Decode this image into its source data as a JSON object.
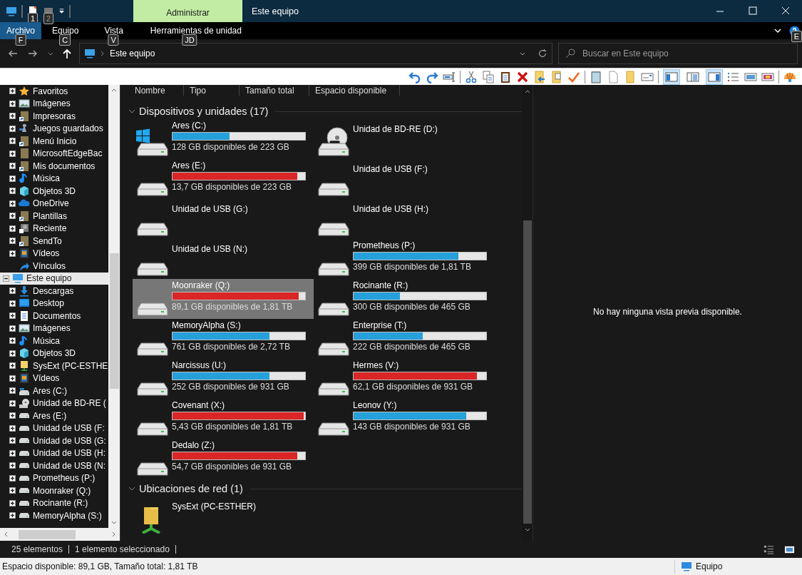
{
  "window": {
    "title": "Este equipo",
    "context_tab": "Administrar"
  },
  "quick_access_keytips": [
    "1",
    "2"
  ],
  "ribbon_tabs": [
    {
      "label": "Archivo",
      "selected": true,
      "keytip": "F"
    },
    {
      "label": "Equipo",
      "selected": false,
      "keytip": "C"
    },
    {
      "label": "Vista",
      "selected": false,
      "keytip": "V"
    },
    {
      "label": "Herramientas de unidad",
      "selected": false,
      "keytip": "JD"
    }
  ],
  "help_keytip": "E",
  "address": {
    "location": "Este equipo"
  },
  "search": {
    "placeholder": "Buscar en Este equipo"
  },
  "view_buttons": [
    {
      "selected": true
    },
    {
      "selected": false
    },
    {
      "selected": true
    }
  ],
  "sidebar": {
    "items": [
      {
        "label": "Favoritos",
        "kind": "star",
        "expandable": true,
        "expanded": false,
        "selected": false
      },
      {
        "label": "Imágenes",
        "kind": "pictures",
        "expandable": true,
        "expanded": false,
        "selected": false
      },
      {
        "label": "Impresoras",
        "kind": "shortcut-folder",
        "expandable": true,
        "expanded": false,
        "selected": false
      },
      {
        "label": "Juegos guardados",
        "kind": "games",
        "expandable": true,
        "expanded": false,
        "selected": false
      },
      {
        "label": "Menú Inicio",
        "kind": "shortcut-folder",
        "expandable": true,
        "expanded": false,
        "selected": false
      },
      {
        "label": "MicrosoftEdgeBac",
        "kind": "folder",
        "expandable": true,
        "expanded": false,
        "selected": false
      },
      {
        "label": "Mis documentos",
        "kind": "shortcut-folder",
        "expandable": true,
        "expanded": false,
        "selected": false
      },
      {
        "label": "Música",
        "kind": "music",
        "expandable": true,
        "expanded": false,
        "selected": false
      },
      {
        "label": "Objetos 3D",
        "kind": "cube",
        "expandable": true,
        "expanded": false,
        "selected": false
      },
      {
        "label": "OneDrive",
        "kind": "cloud",
        "expandable": true,
        "expanded": false,
        "selected": false
      },
      {
        "label": "Plantillas",
        "kind": "shortcut-folder",
        "expandable": true,
        "expanded": false,
        "selected": false
      },
      {
        "label": "Reciente",
        "kind": "recent",
        "expandable": true,
        "expanded": false,
        "selected": false
      },
      {
        "label": "SendTo",
        "kind": "shortcut-folder",
        "expandable": true,
        "expanded": false,
        "selected": false
      },
      {
        "label": "Vídeos",
        "kind": "videos",
        "expandable": true,
        "expanded": false,
        "selected": false
      },
      {
        "label": "Vínculos",
        "kind": "link",
        "expandable": false,
        "selected": false
      },
      {
        "label": "Este equipo",
        "kind": "computer",
        "expandable": true,
        "expanded": true,
        "selected": true,
        "children": [
          {
            "label": "Descargas",
            "kind": "download",
            "expandable": true,
            "expanded": false,
            "selected": false
          },
          {
            "label": "Desktop",
            "kind": "desktop",
            "expandable": true,
            "expanded": false,
            "selected": false
          },
          {
            "label": "Documentos",
            "kind": "documents",
            "expandable": true,
            "expanded": false,
            "selected": false
          },
          {
            "label": "Imágenes",
            "kind": "pictures",
            "expandable": true,
            "expanded": false,
            "selected": false
          },
          {
            "label": "Música",
            "kind": "music",
            "expandable": true,
            "expanded": false,
            "selected": false
          },
          {
            "label": "Objetos 3D",
            "kind": "cube",
            "expandable": true,
            "expanded": false,
            "selected": false
          },
          {
            "label": "SysExt (PC-ESTHE",
            "kind": "network-folder",
            "expandable": true,
            "expanded": false,
            "selected": false
          },
          {
            "label": "Vídeos",
            "kind": "videos",
            "expandable": true,
            "expanded": false,
            "selected": false
          },
          {
            "label": "Ares (C:)",
            "kind": "windows-drive",
            "expandable": true,
            "expanded": false,
            "selected": false
          },
          {
            "label": "Unidad de BD-RE (",
            "kind": "disc-drive",
            "expandable": true,
            "expanded": false,
            "selected": false
          },
          {
            "label": "Ares (E:)",
            "kind": "drive",
            "expandable": true,
            "expanded": false,
            "selected": false
          },
          {
            "label": "Unidad de USB (F:",
            "kind": "drive",
            "expandable": true,
            "expanded": false,
            "selected": false
          },
          {
            "label": "Unidad de USB (G:",
            "kind": "drive",
            "expandable": true,
            "expanded": false,
            "selected": false
          },
          {
            "label": "Unidad de USB (H:",
            "kind": "drive",
            "expandable": true,
            "expanded": false,
            "selected": false
          },
          {
            "label": "Unidad de USB (N:",
            "kind": "drive",
            "expandable": true,
            "expanded": false,
            "selected": false
          },
          {
            "label": "Prometheus (P:)",
            "kind": "drive",
            "expandable": true,
            "expanded": false,
            "selected": false
          },
          {
            "label": "Moonraker (Q:)",
            "kind": "drive",
            "expandable": true,
            "expanded": false,
            "selected": false
          },
          {
            "label": "Rocinante (R:)",
            "kind": "drive",
            "expandable": true,
            "expanded": false,
            "selected": false
          },
          {
            "label": "MemoryAlpha (S:)",
            "kind": "drive",
            "expandable": true,
            "expanded": false,
            "selected": false
          }
        ]
      }
    ]
  },
  "columns": [
    "Nombre",
    "Tipo",
    "Tamaño total",
    "Espacio disponible"
  ],
  "groups": [
    {
      "title": "Dispositivos y unidades (17)",
      "expanded": true,
      "items": [
        {
          "name": "Ares (C:)",
          "kind": "windows-drive",
          "level": 0.43,
          "color": "#26a0da",
          "reading": "128 GB disponibles de 223 GB",
          "selected": false
        },
        {
          "name": "Unidad de BD-RE (D:)",
          "kind": "disc-drive",
          "selected": false
        },
        {
          "name": "Ares (E:)",
          "kind": "drive",
          "level": 0.94,
          "color": "#da2626",
          "reading": "13,7 GB disponibles de 223 GB",
          "selected": false
        },
        {
          "name": "Unidad de USB (F:)",
          "kind": "drive",
          "selected": false
        },
        {
          "name": "Unidad de USB (G:)",
          "kind": "drive",
          "selected": false
        },
        {
          "name": "Unidad de USB (H:)",
          "kind": "drive",
          "selected": false
        },
        {
          "name": "Unidad de USB (N:)",
          "kind": "drive",
          "selected": false
        },
        {
          "name": "Prometheus (P:)",
          "kind": "drive",
          "level": 0.79,
          "color": "#26a0da",
          "reading": "399 GB disponibles de 1,81 TB",
          "selected": false
        },
        {
          "name": "Moonraker (Q:)",
          "kind": "drive",
          "level": 0.95,
          "color": "#da2626",
          "reading": "89,1 GB disponibles de 1,81 TB",
          "selected": true
        },
        {
          "name": "Rocinante (R:)",
          "kind": "drive",
          "level": 0.35,
          "color": "#26a0da",
          "reading": "300 GB disponibles de 465 GB",
          "selected": false
        },
        {
          "name": "MemoryAlpha (S:)",
          "kind": "drive",
          "level": 0.73,
          "color": "#26a0da",
          "reading": "761 GB disponibles de 2,72 TB",
          "selected": false
        },
        {
          "name": "Enterprise (T:)",
          "kind": "drive",
          "level": 0.52,
          "color": "#26a0da",
          "reading": "222 GB disponibles de 465 GB",
          "selected": false
        },
        {
          "name": "Narcissus (U:)",
          "kind": "drive",
          "level": 0.73,
          "color": "#26a0da",
          "reading": "252 GB disponibles de 931 GB",
          "selected": false
        },
        {
          "name": "Hermes (V:)",
          "kind": "drive",
          "level": 0.93,
          "color": "#da2626",
          "reading": "62,1 GB disponibles de 931 GB",
          "selected": false
        },
        {
          "name": "Covenant (X:)",
          "kind": "drive",
          "level": 0.99,
          "color": "#da2626",
          "reading": "5,43 GB disponibles de 1,81 TB",
          "selected": false
        },
        {
          "name": "Leonov (Y:)",
          "kind": "drive",
          "level": 0.85,
          "color": "#26a0da",
          "reading": "143 GB disponibles de 931 GB",
          "selected": false
        },
        {
          "name": "Dedalo (Z:)",
          "kind": "drive",
          "level": 0.94,
          "color": "#da2626",
          "reading": "54,7 GB disponibles de 931 GB",
          "selected": false
        }
      ]
    },
    {
      "title": "Ubicaciones de red (1)",
      "expanded": true,
      "items": [
        {
          "name": "SysExt (PC-ESTHER)",
          "kind": "network-folder",
          "selected": false
        }
      ]
    }
  ],
  "preview": {
    "message": "No hay ninguna vista previa disponible."
  },
  "status_bar": {
    "item_count": "25 elementos",
    "selection": "1 elemento seleccionado"
  },
  "details_bar": {
    "space": "Espacio disponible: 89,1 GB, Tamaño total: 1,81 TB",
    "zone": "Equipo"
  }
}
